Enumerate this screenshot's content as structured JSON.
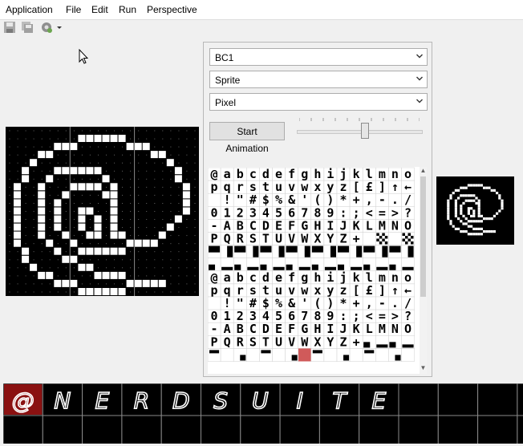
{
  "menubar": {
    "items": [
      "Application",
      "File",
      "Edit",
      "Run",
      "Perspective"
    ]
  },
  "toolbar": {
    "icons": [
      "save-icon",
      "save-all-icon",
      "run-settings-icon",
      "dropdown-arrow-icon"
    ]
  },
  "panel": {
    "platform_select": "BC1",
    "mode_select": "Sprite",
    "draw_select": "Pixel",
    "start_animation_label": "Start Animation",
    "speed_slider_level": 0.57
  },
  "charset": {
    "rows": [
      "@abcdefghijklmno",
      "pqrstuvwxyz[£]↑←",
      " !\"#$%&'()*+,-./",
      "0123456789:;<=>?",
      "-ABCDEFGHIJKLMNO",
      "PQRSTUVWXYZ+",
      "",
      "",
      "@abcdefghijklmno",
      "pqrstuvwxyz[£]↑←",
      " !\"#$%&'()*+,-./",
      "0123456789:;<=>?",
      "-ABCDEFGHIJKLMNO",
      "PQRSTUVWXYZ+"
    ],
    "selected_highlight_color": "#d05a5a"
  },
  "colors": {
    "editor_bg": "#000000",
    "pixel_on": "#ffffff",
    "selection": "#d05a5a",
    "grid": "#7a7a7a"
  },
  "strip": {
    "frames": [
      "@",
      "N",
      "E",
      "R",
      "D",
      "S",
      "U",
      "I",
      "T",
      "E"
    ]
  }
}
